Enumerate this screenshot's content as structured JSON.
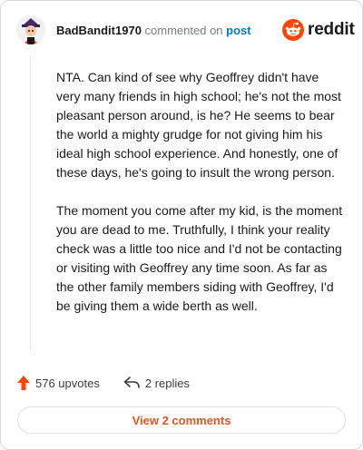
{
  "comment": {
    "username": "BadBandit1970",
    "action_text": "commented on",
    "post_link": "post",
    "paragraphs": [
      "NTA. Can kind of see why Geoffrey didn't have very many friends in high school; he's not the most pleasant person around, is he? He seems to bear the world a mighty grudge for not giving him his ideal high school experience. And honestly, one of these days, he's going to insult the wrong person.",
      "The moment you come after my kid, is the moment you are dead to me. Truthfully, I think your reality check was a little too nice and I'd not be contacting or visiting with Geoffrey any time soon. As far as the other family members siding with Geoffrey, I'd be giving them a wide berth as well."
    ]
  },
  "brand": {
    "wordmark": "reddit",
    "color": "#ff4500"
  },
  "actions": {
    "upvotes": "576 upvotes",
    "replies": "2 replies"
  },
  "view_comments_label": "View 2 comments",
  "icons": {
    "upvote": "upvote-arrow-icon",
    "reply": "reply-arrow-icon",
    "logo": "reddit-snoo-icon",
    "avatar": "user-avatar"
  },
  "colors": {
    "upvote": "#ff4500",
    "link": "#0079d3",
    "view_button_text": "#e8541b"
  }
}
